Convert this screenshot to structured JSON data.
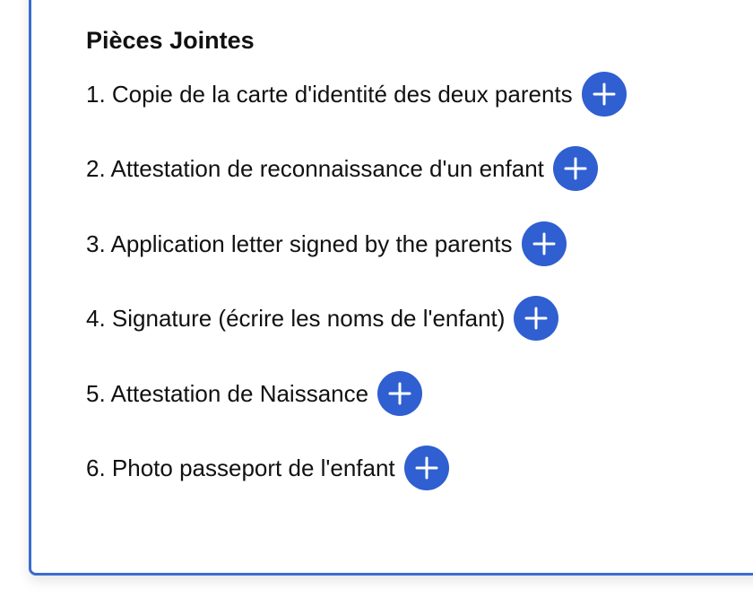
{
  "colors": {
    "accent": "#2f5fd0",
    "card_border": "#3a6cd0",
    "text": "#111111"
  },
  "section": {
    "title": "Pièces Jointes",
    "items": [
      {
        "label": "1. Copie de la carte d'identité des deux parents",
        "icon": "plus-icon"
      },
      {
        "label": "2. Attestation de reconnaissance d'un enfant",
        "icon": "plus-icon"
      },
      {
        "label": "3. Application letter signed by the parents",
        "icon": "plus-icon"
      },
      {
        "label": "4. Signature (écrire les noms de l'enfant)",
        "icon": "plus-icon"
      },
      {
        "label": "5. Attestation de Naissance",
        "icon": "plus-icon"
      },
      {
        "label": "6. Photo passeport de l'enfant",
        "icon": "plus-icon"
      }
    ]
  }
}
